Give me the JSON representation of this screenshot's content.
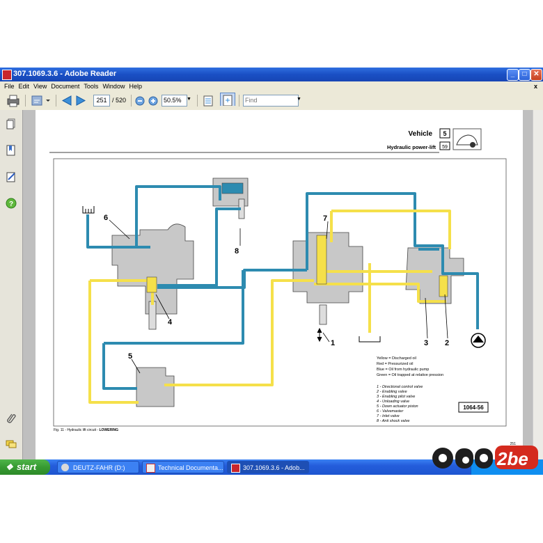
{
  "window": {
    "title": "307.1069.3.6  - Adobe Reader",
    "controls": {
      "minimize": "_",
      "maximize": "□",
      "close": "✕"
    }
  },
  "menubar": {
    "items": [
      "File",
      "Edit",
      "View",
      "Document",
      "Tools",
      "Window",
      "Help"
    ],
    "close_glyph": "x"
  },
  "toolbar": {
    "page_current": "251",
    "page_total": "/ 520",
    "zoom": "50.5%",
    "find_placeholder": "Find"
  },
  "document": {
    "header_title": "Vehicle",
    "header_chapter": "5",
    "header_subtitle": "Hydraulic power-lift",
    "header_page": "59",
    "callouts": [
      "6",
      "8",
      "7",
      "4",
      "1",
      "3",
      "2",
      "5"
    ],
    "legend_colors": [
      "Yellow  = Discharged oil",
      "Red = Pressurized oil",
      "Blue = Oil from hydraulic pump",
      "Green = Oil trapped at relative pression"
    ],
    "legend_parts": [
      "1 - Directional control valve",
      "2 - Enabling valve",
      "3 - Enabling pilot valve",
      "4 - Unloading valve",
      "5 - Down actuator piston",
      "6 - Valvemaster",
      "7 - Inlet valve",
      "8 - Anti shock valve"
    ],
    "figure_code": "1064-56",
    "caption_prefix": "Fig. 11 - Hydraulic lift circuit - ",
    "caption_mode": "LOWERING",
    "page_number": "251",
    "colors": {
      "blue_oil": "#2d8bb0",
      "yellow_oil": "#f5e04a",
      "body_grey": "#b8b8b8"
    }
  },
  "taskbar": {
    "start_label": "start",
    "items": [
      {
        "label": "DEUTZ-FAHR (D:)"
      },
      {
        "label": "Technical Documenta..."
      },
      {
        "label": "307.1069.3.6 - Adob..."
      }
    ]
  },
  "watermark": {
    "text": "OBD2be"
  }
}
